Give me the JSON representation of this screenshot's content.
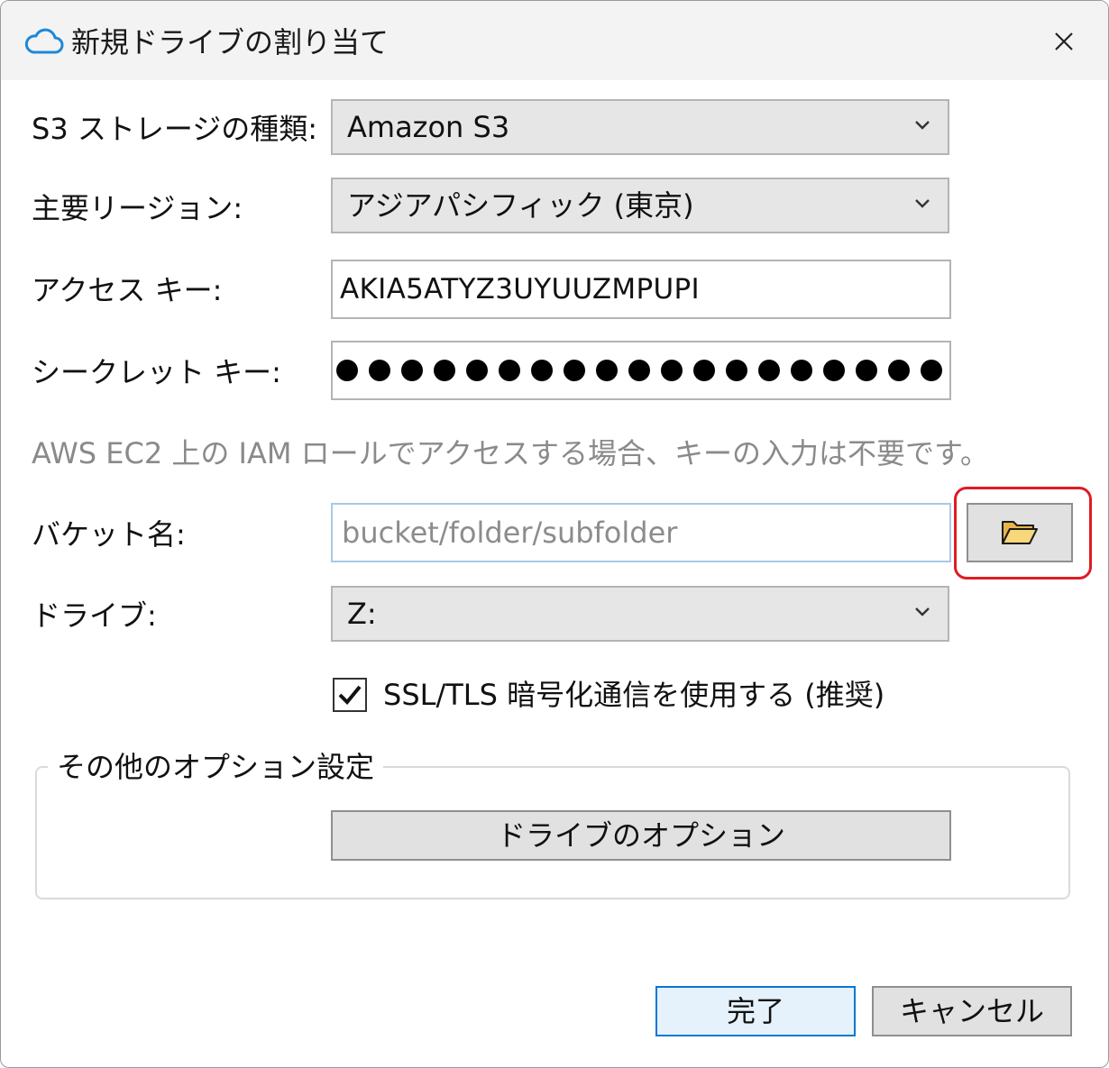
{
  "window": {
    "title": "新規ドライブの割り当て",
    "icon": "cloud-icon",
    "close_icon": "close-icon"
  },
  "form": {
    "storage_type": {
      "label": "S3 ストレージの種類:",
      "value": "Amazon S3"
    },
    "region": {
      "label": "主要リージョン:",
      "value": "アジアパシフィック (東京)"
    },
    "access_key": {
      "label": "アクセス キー:",
      "value": "AKIA5ATYZ3UYUUZMPUPI"
    },
    "secret_key": {
      "label": "シークレット キー:",
      "masked_length": 19
    },
    "iam_hint": "AWS EC2 上の IAM ロールでアクセスする場合、キーの入力は不要です。",
    "bucket": {
      "label": "バケット名:",
      "placeholder": "bucket/folder/subfolder",
      "browse_icon": "folder-open-icon"
    },
    "drive": {
      "label": "ドライブ:",
      "value": "Z:"
    },
    "ssl": {
      "label": "SSL/TLS 暗号化通信を使用する (推奨)",
      "checked": true
    }
  },
  "other_options": {
    "group_title": "その他のオプション設定",
    "button_label": "ドライブのオプション"
  },
  "footer": {
    "ok_label": "完了",
    "cancel_label": "キャンセル"
  },
  "colors": {
    "accent": "#0078d4",
    "highlight": "#e01b24",
    "folder": "#f5c542"
  }
}
